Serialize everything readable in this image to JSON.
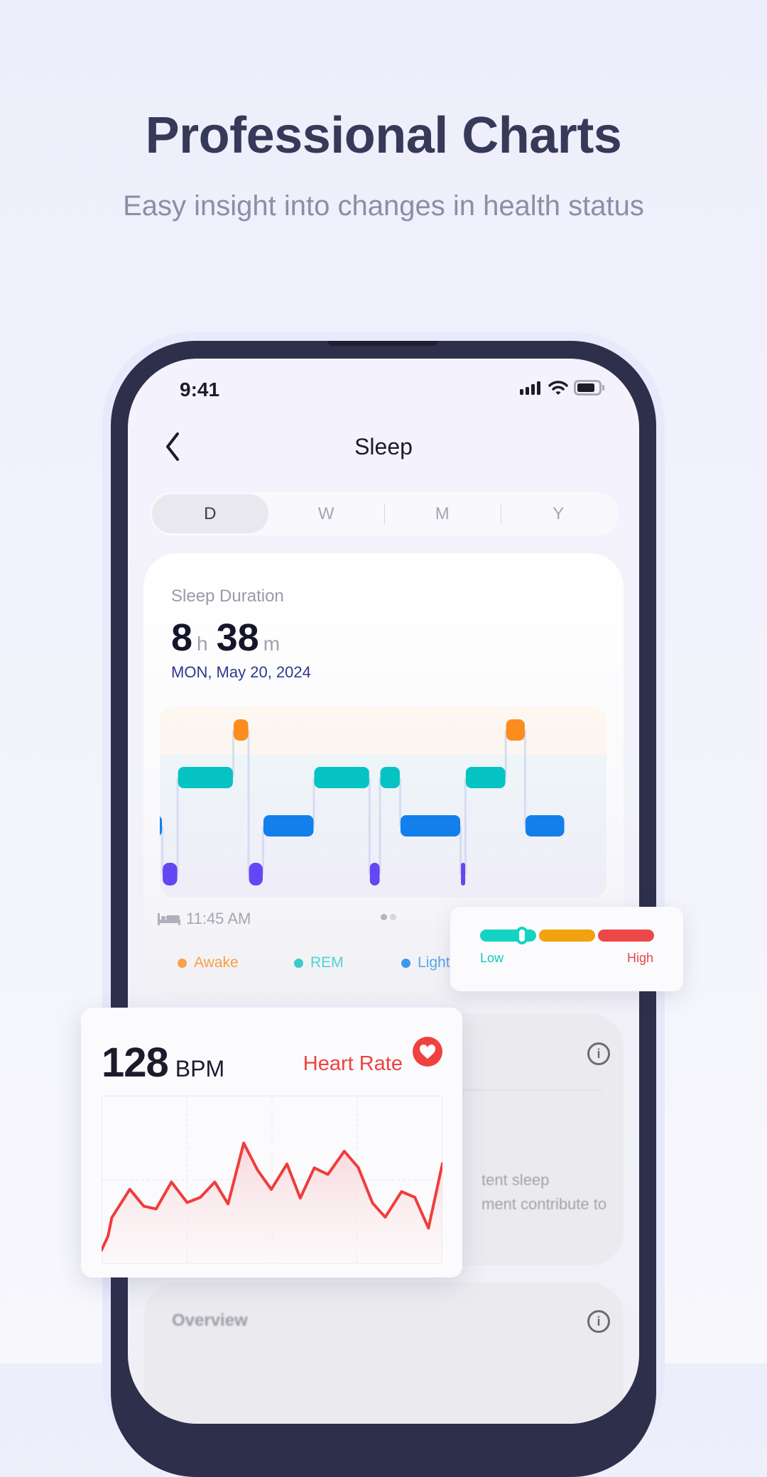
{
  "hero": {
    "title": "Professional Charts",
    "subtitle": "Easy insight into changes in health status"
  },
  "status_bar": {
    "time": "9:41"
  },
  "nav": {
    "title": "Sleep"
  },
  "tabs": [
    {
      "label": "D",
      "active": true
    },
    {
      "label": "W"
    },
    {
      "label": "M"
    },
    {
      "label": "Y"
    }
  ],
  "sleep_card": {
    "label": "Sleep Duration",
    "hours": "8",
    "hours_unit": "h",
    "minutes": "38",
    "minutes_unit": "m",
    "date": "MON, May 20, 2024",
    "bed_time": "11:45 AM",
    "legend": [
      {
        "label": "Awake",
        "color": "#fb8c1e"
      },
      {
        "label": "REM",
        "color": "#05c3c3"
      },
      {
        "label": "Light",
        "color": "#127fea"
      }
    ]
  },
  "chart_data": [
    {
      "type": "bar",
      "stages": [
        "Awake",
        "REM",
        "Light",
        "Deep"
      ],
      "stage_colors": {
        "Awake": "#fb8c1e",
        "REM": "#05c3c3",
        "Light": "#127fea",
        "Deep": "#6347f2"
      },
      "x_unit": "minutes",
      "total_minutes": 518,
      "segments": [
        {
          "stage": "Light",
          "minutes": 19
        },
        {
          "stage": "Deep",
          "minutes": 19
        },
        {
          "stage": "REM",
          "minutes": 69
        },
        {
          "stage": "Awake",
          "minutes": 19
        },
        {
          "stage": "Deep",
          "minutes": 18
        },
        {
          "stage": "Light",
          "minutes": 63
        },
        {
          "stage": "REM",
          "minutes": 69
        },
        {
          "stage": "Deep",
          "minutes": 13
        },
        {
          "stage": "REM",
          "minutes": 25
        },
        {
          "stage": "Light",
          "minutes": 75
        },
        {
          "stage": "Deep",
          "minutes": 6
        },
        {
          "stage": "REM",
          "minutes": 50
        },
        {
          "stage": "Awake",
          "minutes": 24
        },
        {
          "stage": "Light",
          "minutes": 49
        }
      ]
    },
    {
      "type": "area",
      "title": "Heart Rate",
      "color": "#f03c3c",
      "grid": true,
      "x": [
        0,
        1.9,
        3.0,
        8.3,
        12.4,
        16.0,
        20.5,
        25.1,
        29.0,
        33.2,
        37.1,
        41.7,
        45.8,
        49.8,
        54.4,
        58.3,
        62.4,
        66.4,
        71.2,
        75.3,
        79.5,
        83.2,
        88.0,
        91.9,
        95.9,
        100
      ],
      "y": [
        8.3,
        16.5,
        27.5,
        44.4,
        34.3,
        32.7,
        48.7,
        36.5,
        39.6,
        48.7,
        35.7,
        71.8,
        55.7,
        44.3,
        59.4,
        39.1,
        57.1,
        53.2,
        67.0,
        57.4,
        36.2,
        27.8,
        43.0,
        39.6,
        21.3,
        59.7
      ],
      "xlim": [
        0,
        100
      ],
      "ylim": [
        0,
        100
      ]
    }
  ],
  "level_card": {
    "low_label": "Low",
    "high_label": "High",
    "level": 0.2,
    "colors": [
      "#14d3c2",
      "#f2a20f",
      "#ec4848"
    ]
  },
  "heart_card": {
    "value": "128",
    "unit": "BPM",
    "label": "Heart Rate",
    "color": "#f04141"
  },
  "background_cards": {
    "text_line_1": "tent sleep",
    "text_line_2": "ment contribute to",
    "overview_title": "Overview"
  }
}
